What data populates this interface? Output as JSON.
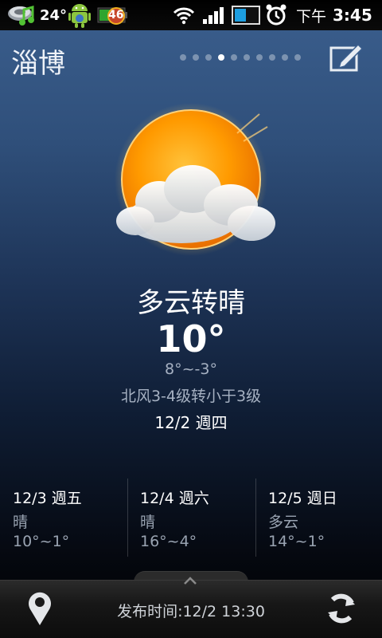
{
  "status_bar": {
    "temperature": "24°",
    "battery": "46",
    "time_period": "下午",
    "time": "3:45",
    "icons": [
      "weather-cloud-icon",
      "music-note-icon",
      "android-icon",
      "battery-icon",
      "wifi-icon",
      "signal-icon",
      "sync-icon",
      "alarm-icon"
    ]
  },
  "header": {
    "city": "淄博",
    "page_count": 10,
    "active_page": 4,
    "edit_icon": "edit-icon"
  },
  "current": {
    "icon": "partly-cloudy-sun-icon",
    "condition": "多云转晴",
    "temperature": "10°",
    "range": "8°~-3°",
    "wind": "北风3-4级转小于3级",
    "date": "12/2 週四"
  },
  "forecast": [
    {
      "date": "12/3 週五",
      "condition": "晴",
      "range": "10°~1°"
    },
    {
      "date": "12/4 週六",
      "condition": "晴",
      "range": "16°~4°"
    },
    {
      "date": "12/5 週日",
      "condition": "多云",
      "range": "14°~1°"
    }
  ],
  "bottom_bar": {
    "publish_time": "发布时间:12/2 13:30",
    "location_icon": "location-pin-icon",
    "refresh_icon": "refresh-icon",
    "handle_icon": "chevron-up-icon"
  },
  "colors": {
    "background_top": "#3b5f8e",
    "background_bottom": "#000000",
    "sun": "#ff9a00",
    "secondary_text": "#a6b1c2"
  }
}
